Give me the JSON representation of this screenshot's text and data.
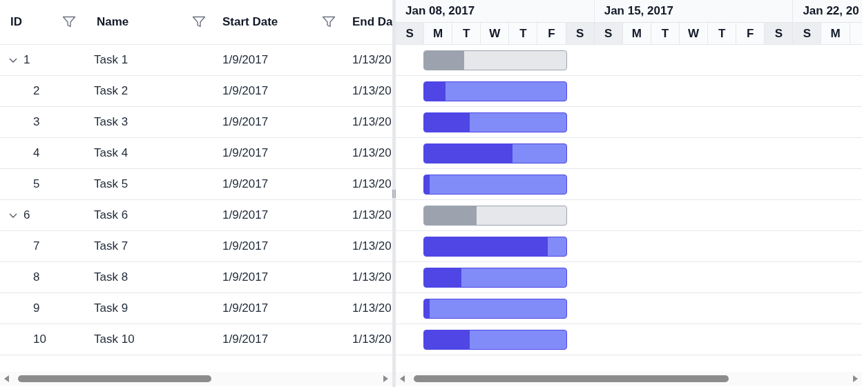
{
  "columns": [
    {
      "label": "ID",
      "filter": true
    },
    {
      "label": "Name",
      "filter": true
    },
    {
      "label": "Start Date",
      "filter": true
    },
    {
      "label": "End Da",
      "filter": false
    }
  ],
  "weeks": [
    {
      "label": "Jan 08, 2017",
      "days": [
        {
          "label": "S",
          "weekend": true
        },
        {
          "label": "M",
          "weekend": false
        },
        {
          "label": "T",
          "weekend": false
        },
        {
          "label": "W",
          "weekend": false
        },
        {
          "label": "T",
          "weekend": false
        },
        {
          "label": "F",
          "weekend": false
        },
        {
          "label": "S",
          "weekend": true
        }
      ]
    },
    {
      "label": "Jan 15, 2017",
      "days": [
        {
          "label": "S",
          "weekend": true
        },
        {
          "label": "M",
          "weekend": false
        },
        {
          "label": "T",
          "weekend": false
        },
        {
          "label": "W",
          "weekend": false
        },
        {
          "label": "T",
          "weekend": false
        },
        {
          "label": "F",
          "weekend": false
        },
        {
          "label": "S",
          "weekend": true
        }
      ]
    },
    {
      "label": "Jan 22, 20",
      "days": [
        {
          "label": "S",
          "weekend": true
        },
        {
          "label": "M",
          "weekend": false
        }
      ]
    }
  ],
  "rows": [
    {
      "id": "1",
      "name": "Task 1",
      "start": "1/9/2017",
      "end": "1/13/20",
      "expanded": true,
      "level": 0.28,
      "children": [
        {
          "id": "2",
          "name": "Task 2",
          "start": "1/9/2017",
          "end": "1/13/20",
          "level": 0.15
        },
        {
          "id": "3",
          "name": "Task 3",
          "start": "1/9/2017",
          "end": "1/13/20",
          "level": 0.32
        },
        {
          "id": "4",
          "name": "Task 4",
          "start": "1/9/2017",
          "end": "1/13/20",
          "level": 0.62
        },
        {
          "id": "5",
          "name": "Task 5",
          "start": "1/9/2017",
          "end": "1/13/20",
          "level": 0.04
        }
      ]
    },
    {
      "id": "6",
      "name": "Task 6",
      "start": "1/9/2017",
      "end": "1/13/20",
      "expanded": true,
      "level": 0.37,
      "children": [
        {
          "id": "7",
          "name": "Task 7",
          "start": "1/9/2017",
          "end": "1/13/20",
          "level": 0.87
        },
        {
          "id": "8",
          "name": "Task 8",
          "start": "1/9/2017",
          "end": "1/13/20",
          "level": 0.26
        },
        {
          "id": "9",
          "name": "Task 9",
          "start": "1/9/2017",
          "end": "1/13/20",
          "level": 0.04
        },
        {
          "id": "10",
          "name": "Task 10",
          "start": "1/9/2017",
          "end": "1/13/20",
          "level": 0.32
        }
      ]
    }
  ]
}
